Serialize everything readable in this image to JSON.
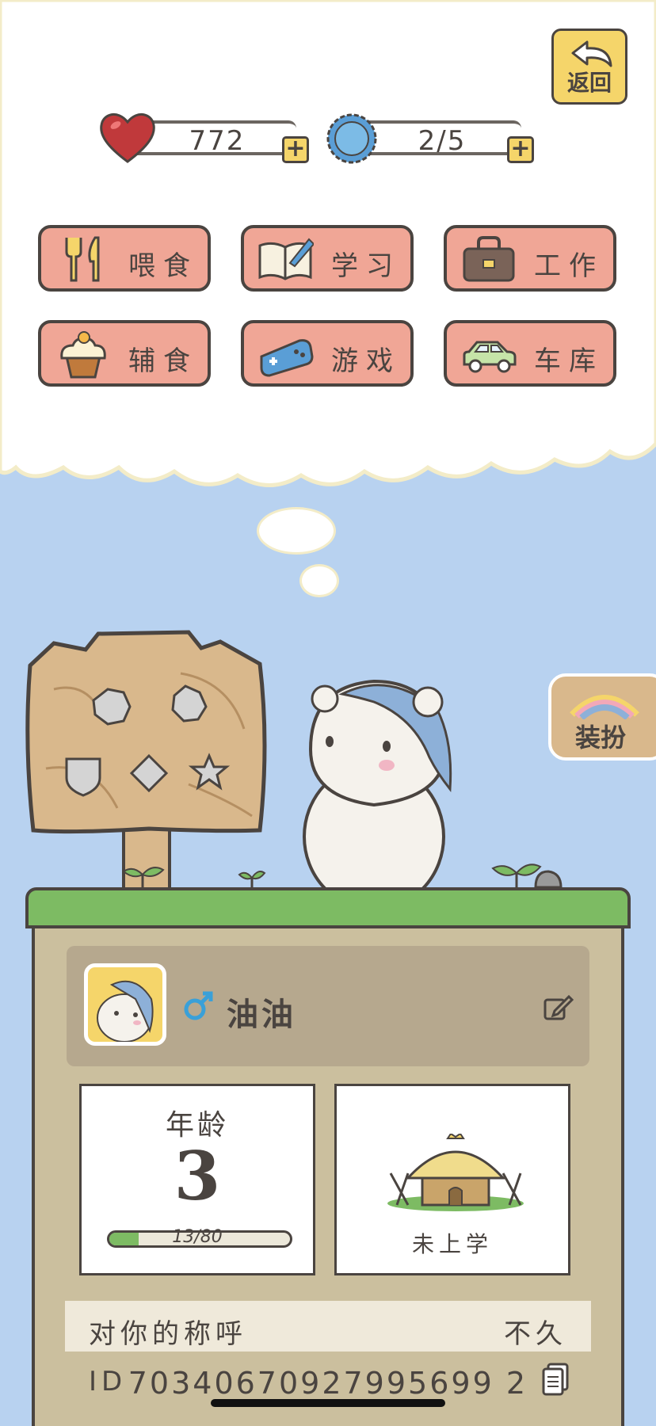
{
  "header": {
    "back_label": "返回"
  },
  "stats": {
    "hearts": "772",
    "hearts_icon": "heart-icon",
    "caps": "2/5",
    "caps_icon": "bottle-cap-icon"
  },
  "menu": [
    {
      "label": "喂食",
      "icon": "fork-knife-icon"
    },
    {
      "label": "学习",
      "icon": "book-pen-icon"
    },
    {
      "label": "工作",
      "icon": "briefcase-icon"
    },
    {
      "label": "辅食",
      "icon": "cupcake-icon"
    },
    {
      "label": "游戏",
      "icon": "gamepad-icon"
    },
    {
      "label": "车库",
      "icon": "car-icon"
    }
  ],
  "dress_up": {
    "label": "装扮"
  },
  "pet": {
    "name": "油油",
    "gender_icon": "male-icon",
    "age_label": "年龄",
    "age_value": "3",
    "age_progress_text": "13/80",
    "age_progress_fraction": 0.1625,
    "school_status": "未上学"
  },
  "info": {
    "nickname_key": "对你的称呼",
    "nickname_value": "不久",
    "id_key": "ID",
    "id_value": "70340670927995699 2"
  },
  "colors": {
    "sky": "#b8d2f0",
    "menu_button": "#f0a696",
    "accent_yellow": "#f5d56a",
    "grass": "#7dbb63",
    "panel": "#cbbf9e"
  }
}
